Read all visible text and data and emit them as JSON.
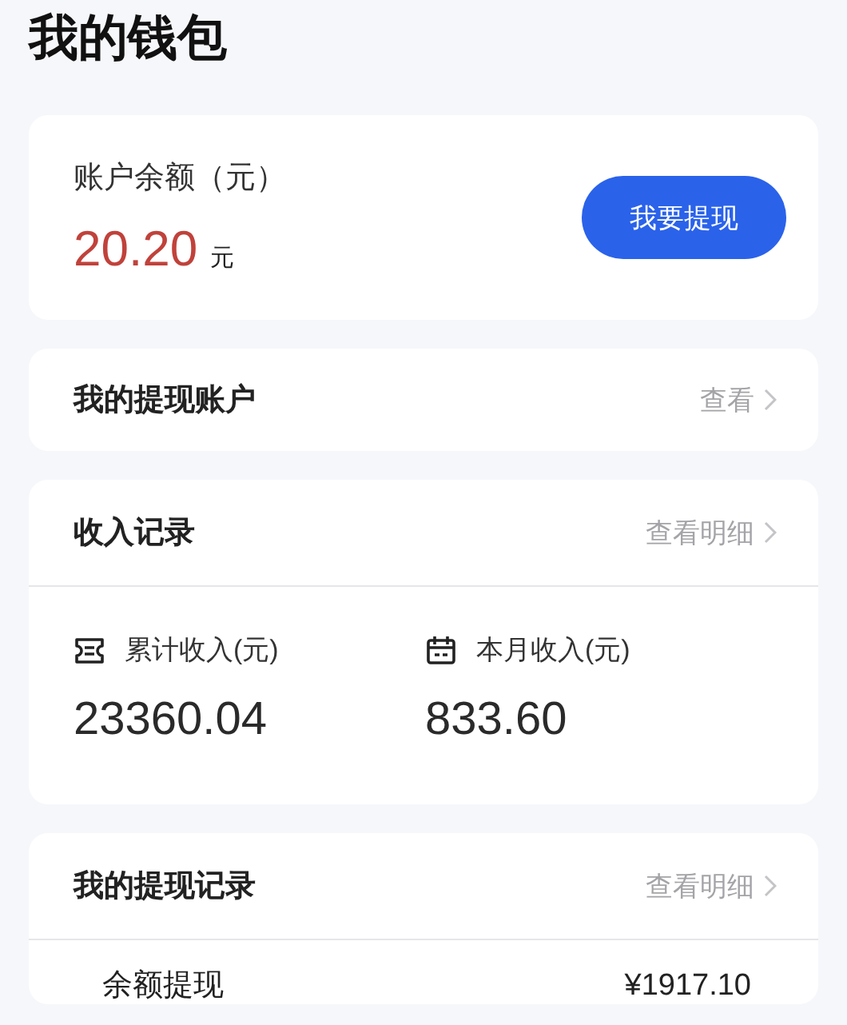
{
  "title": "我的钱包",
  "balance": {
    "label": "账户余额（元）",
    "amount": "20.20",
    "unit": "元",
    "button": "我要提现"
  },
  "account": {
    "title": "我的提现账户",
    "link": "查看"
  },
  "income": {
    "title": "收入记录",
    "link": "查看明细",
    "stats": [
      {
        "kind": "ticket",
        "label": "累计收入(元)",
        "value": "23360.04"
      },
      {
        "kind": "calendar",
        "label": "本月收入(元)",
        "value": "833.60"
      }
    ]
  },
  "withdrawals": {
    "title": "我的提现记录",
    "link": "查看明细",
    "rows": [
      {
        "label": "余额提现",
        "amount": "¥1917.10"
      }
    ]
  }
}
